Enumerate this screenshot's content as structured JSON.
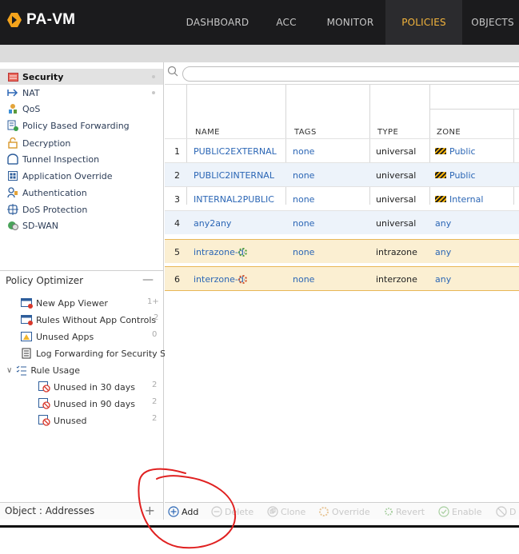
{
  "app": {
    "title": "PA-VM"
  },
  "nav": [
    {
      "label": "DASHBOARD",
      "active": false
    },
    {
      "label": "ACC",
      "active": false
    },
    {
      "label": "MONITOR",
      "active": false
    },
    {
      "label": "POLICIES",
      "active": true
    },
    {
      "label": "OBJECTS",
      "active": false
    }
  ],
  "sidebar": {
    "items": [
      {
        "label": "Security",
        "icon": "security-rule-icon",
        "selected": true
      },
      {
        "label": "NAT",
        "icon": "nat-arrow-icon"
      },
      {
        "label": "QoS",
        "icon": "qos-icon"
      },
      {
        "label": "Policy Based Forwarding",
        "icon": "pbf-icon"
      },
      {
        "label": "Decryption",
        "icon": "decryption-lock-icon"
      },
      {
        "label": "Tunnel Inspection",
        "icon": "tunnel-inspection-icon"
      },
      {
        "label": "Application Override",
        "icon": "application-override-icon"
      },
      {
        "label": "Authentication",
        "icon": "authentication-icon"
      },
      {
        "label": "DoS Protection",
        "icon": "dos-protection-icon"
      },
      {
        "label": "SD-WAN",
        "icon": "sdwan-icon"
      }
    ]
  },
  "optimizer": {
    "title": "Policy Optimizer",
    "collapse": "—",
    "items": [
      {
        "label": "New App Viewer",
        "count": "1+"
      },
      {
        "label": "Rules Without App Controls",
        "count": "2"
      },
      {
        "label": "Unused Apps",
        "count": "0"
      },
      {
        "label": "Log Forwarding for Security Ser",
        "count": ""
      },
      {
        "label": "Rule Usage",
        "count": ""
      },
      {
        "label": "Unused in 30 days",
        "count": "2"
      },
      {
        "label": "Unused in 90 days",
        "count": "2"
      },
      {
        "label": "Unused",
        "count": "2"
      }
    ]
  },
  "objects": {
    "label": "Object : Addresses",
    "add": "+"
  },
  "table": {
    "headers": {
      "name": "NAME",
      "tags": "TAGS",
      "type": "TYPE",
      "zone": "ZONE"
    },
    "rows": [
      {
        "num": "1",
        "name": "PUBLIC2EXTERNAL",
        "tags": "none",
        "type": "universal",
        "zone": "Public"
      },
      {
        "num": "2",
        "name": "PUBLIC2INTERNAL",
        "tags": "none",
        "type": "universal",
        "zone": "Public"
      },
      {
        "num": "3",
        "name": "INTERNAL2PUBLIC",
        "tags": "none",
        "type": "universal",
        "zone": "Internal"
      },
      {
        "num": "4",
        "name": "any2any",
        "tags": "none",
        "type": "universal",
        "zone": "any"
      },
      {
        "num": "5",
        "name": "intrazone-default",
        "tags": "none",
        "type": "intrazone",
        "zone": "any"
      },
      {
        "num": "6",
        "name": "interzone-default",
        "tags": "none",
        "type": "interzone",
        "zone": "any"
      }
    ]
  },
  "toolbar": {
    "add": "Add",
    "delete": "Delete",
    "clone": "Clone",
    "override": "Override",
    "revert": "Revert",
    "enable": "Enable",
    "disable": "D"
  },
  "colors": {
    "accent": "#f3b43c",
    "link": "#2b66b5",
    "highlight_row": "#fbefd2",
    "annotation": "#e02020"
  }
}
